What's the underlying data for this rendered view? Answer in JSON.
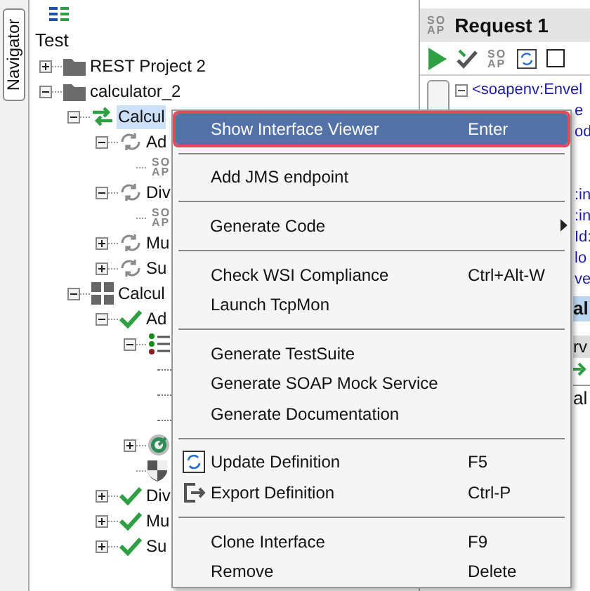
{
  "navigator": {
    "label": "Navigator"
  },
  "tree": {
    "root": "Test",
    "items": [
      {
        "kind": "folder",
        "label": "REST Project 2",
        "expanded": false
      },
      {
        "kind": "folder",
        "label": "calculator_2",
        "expanded": true,
        "children": [
          {
            "kind": "interface",
            "label": "Calcul",
            "selected": true,
            "expanded": true,
            "children": [
              {
                "kind": "operation",
                "label": "Ad",
                "expanded": true,
                "children": [
                  {
                    "kind": "soap",
                    "badge": [
                      "SO",
                      "AP"
                    ]
                  }
                ]
              },
              {
                "kind": "operation",
                "label": "Div",
                "expanded": true,
                "children": [
                  {
                    "kind": "soap",
                    "badge": [
                      "SO",
                      "AP"
                    ]
                  }
                ]
              },
              {
                "kind": "operation",
                "label": "Mu",
                "expanded": false
              },
              {
                "kind": "operation",
                "label": "Su",
                "expanded": false
              }
            ]
          },
          {
            "kind": "grid",
            "label": "Calcul",
            "selected": false,
            "expanded": true,
            "children": [
              {
                "kind": "check",
                "label": "Ad",
                "expanded": true,
                "children": [
                  {
                    "kind": "list",
                    "expanded": true,
                    "children": [
                      {
                        "kind": "covered"
                      },
                      {
                        "kind": "covered"
                      },
                      {
                        "kind": "covered"
                      }
                    ]
                  },
                  {
                    "kind": "target",
                    "expanded": false
                  },
                  {
                    "kind": "shield"
                  }
                ]
              },
              {
                "kind": "check",
                "label": "Div",
                "expanded": false
              },
              {
                "kind": "check",
                "label": "Mu",
                "expanded": false
              },
              {
                "kind": "check",
                "label": "Su",
                "expanded": false
              }
            ]
          }
        ]
      }
    ]
  },
  "request": {
    "badge": [
      "SO",
      "AP"
    ],
    "title": "Request 1",
    "toolbar_badge": [
      "SO",
      "AP"
    ],
    "lines": [
      {
        "text": "<soapenv:Envel",
        "kind": "tag"
      },
      {
        "text": "e",
        "kind": "fragment"
      },
      {
        "text": "od",
        "kind": "fragment"
      },
      {
        "kind": "blank"
      },
      {
        "kind": "blank"
      },
      {
        "text": ":in",
        "kind": "fragment"
      },
      {
        "text": ":in",
        "kind": "fragment"
      },
      {
        "text": "Id:",
        "kind": "fragment"
      },
      {
        "text": "lo",
        "kind": "fragment"
      },
      {
        "text": "ve",
        "kind": "fragment"
      }
    ]
  },
  "lower_panel": {
    "header": "al",
    "subheader": "rv",
    "label": "al"
  },
  "context_menu": [
    {
      "kind": "item",
      "label": "Show Interface Viewer",
      "shortcut": "Enter",
      "selected": true
    },
    {
      "kind": "separator"
    },
    {
      "kind": "item",
      "label": "Add JMS endpoint",
      "selected": false
    },
    {
      "kind": "separator"
    },
    {
      "kind": "submenu",
      "label": "Generate Code",
      "selected": false
    },
    {
      "kind": "separator"
    },
    {
      "kind": "item",
      "label": "Check WSI Compliance",
      "shortcut": "Ctrl+Alt-W",
      "selected": false
    },
    {
      "kind": "item",
      "label": "Launch TcpMon",
      "selected": false
    },
    {
      "kind": "separator"
    },
    {
      "kind": "item",
      "label": "Generate TestSuite",
      "selected": false
    },
    {
      "kind": "item",
      "label": "Generate SOAP Mock Service",
      "selected": false
    },
    {
      "kind": "item",
      "label": "Generate Documentation",
      "selected": false
    },
    {
      "kind": "separator"
    },
    {
      "kind": "update",
      "label": "Update Definition",
      "shortcut": "F5",
      "selected": false
    },
    {
      "kind": "export",
      "label": "Export Definition",
      "shortcut": "Ctrl-P",
      "selected": false
    },
    {
      "kind": "separator"
    },
    {
      "kind": "item",
      "label": "Clone Interface",
      "shortcut": "F9",
      "selected": false
    },
    {
      "kind": "item",
      "label": "Remove",
      "shortcut": "Delete",
      "selected": false
    }
  ]
}
